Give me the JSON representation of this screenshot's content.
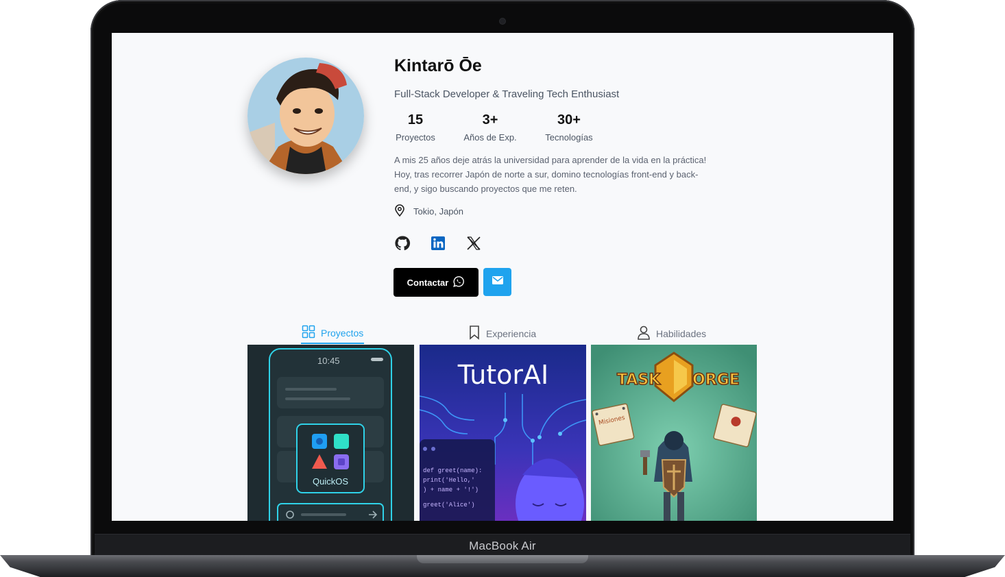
{
  "device": {
    "label": "MacBook Air"
  },
  "profile": {
    "name": "Kintarō Ōe",
    "title": "Full-Stack Developer & Traveling Tech Enthusiast",
    "bio": "A mis 25 años deje atrás la universidad para aprender de la vida en la práctica! Hoy, tras recorrer Japón de norte a sur, domino tecnologías front-end y back-end, y sigo buscando proyectos que me reten.",
    "location": "Tokio, Japón"
  },
  "stats": [
    {
      "value": "15",
      "label": "Proyectos"
    },
    {
      "value": "3+",
      "label": "Años de Exp."
    },
    {
      "value": "30+",
      "label": "Tecnologías"
    }
  ],
  "social": [
    {
      "icon": "github-icon"
    },
    {
      "icon": "linkedin-icon"
    },
    {
      "icon": "x-icon"
    }
  ],
  "actions": {
    "contact_label": "Contactar"
  },
  "tabs": [
    {
      "label": "Proyectos",
      "icon": "grid-icon",
      "active": true
    },
    {
      "label": "Experiencia",
      "icon": "bookmark-icon",
      "active": false
    },
    {
      "label": "Habilidades",
      "icon": "user-icon",
      "active": false
    }
  ],
  "projects": [
    {
      "time": "10:45",
      "app_name": "QuickOS"
    },
    {
      "title": "TutorAI",
      "code": [
        "def greet(name):",
        "  print('Hello,'",
        ")    + name + '!')",
        "greet('Alice')"
      ]
    },
    {
      "title_left": "TASK",
      "title_right": "ORGE",
      "note": "Misiones"
    }
  ],
  "colors": {
    "accent": "#1fa3ee",
    "dark": "#000000",
    "linkedin": "#0a66c2"
  }
}
